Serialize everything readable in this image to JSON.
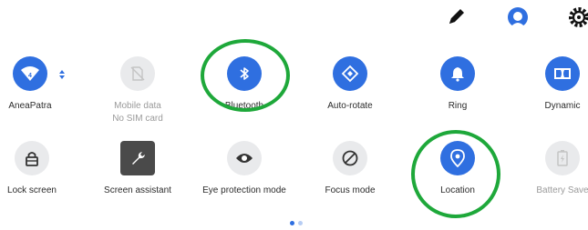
{
  "topbar": {
    "icons": [
      "pencil-icon",
      "user-avatar-icon",
      "settings-gear-icon"
    ]
  },
  "tiles": [
    {
      "id": "wifi",
      "label": "AneaPatra",
      "icon": "wifi-icon",
      "state": "on"
    },
    {
      "id": "mobile_data",
      "label": "Mobile data",
      "sublabel": "No SIM card",
      "icon": "sim-card-icon",
      "state": "unavailable"
    },
    {
      "id": "bluetooth",
      "label": "Bluetooth",
      "icon": "bluetooth-icon",
      "state": "on"
    },
    {
      "id": "auto_rotate",
      "label": "Auto-rotate",
      "icon": "rotate-icon",
      "state": "on"
    },
    {
      "id": "ring",
      "label": "Ring",
      "icon": "bell-icon",
      "state": "on"
    },
    {
      "id": "dynamic",
      "label": "Dynamic",
      "icon": "dolby-icon",
      "state": "on"
    },
    {
      "id": "lock_screen",
      "label": "Lock screen",
      "icon": "lock-icon",
      "state": "off"
    },
    {
      "id": "screen_assistant",
      "label": "Screen assistant",
      "icon": "wrench-icon",
      "state": "off"
    },
    {
      "id": "eye_protection",
      "label": "Eye protection mode",
      "icon": "eye-icon",
      "state": "off"
    },
    {
      "id": "focus_mode",
      "label": "Focus mode",
      "icon": "focus-mode-icon",
      "state": "off"
    },
    {
      "id": "location",
      "label": "Location",
      "icon": "location-pin-icon",
      "state": "on"
    },
    {
      "id": "battery_saver",
      "label": "Battery Save",
      "icon": "battery-icon",
      "state": "unavailable"
    }
  ],
  "wifi_signal": "4",
  "highlights": [
    "bluetooth",
    "location"
  ],
  "pager": {
    "pages": 2,
    "current": 1
  },
  "colors": {
    "accent": "#2f6fe0",
    "off_tile": "#e9eaec",
    "highlight": "#1ea83a"
  }
}
